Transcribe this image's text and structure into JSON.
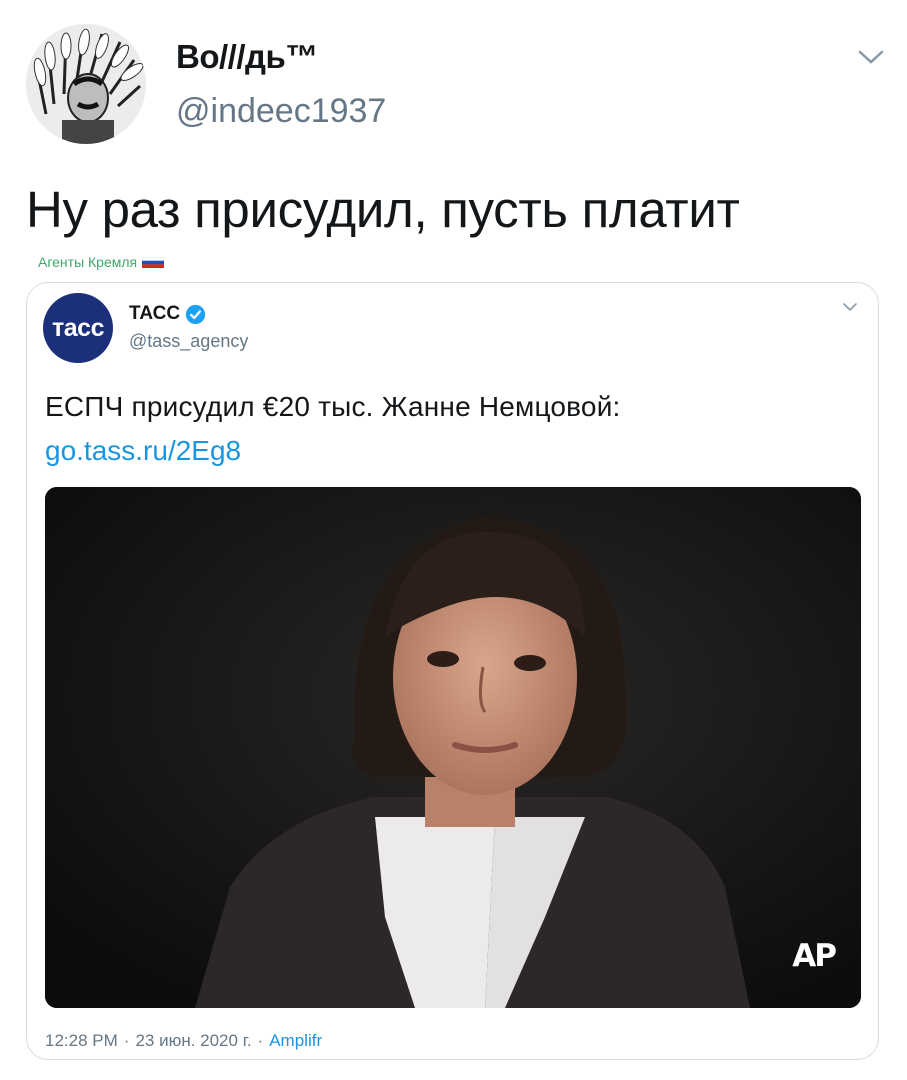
{
  "tweet": {
    "display_name": "Во///дь™",
    "handle": "@indeec1937",
    "text": "Ну раз присудил, пусть платит",
    "watermark": "Агенты Кремля",
    "avatar_icon": "profile-portrait-icon",
    "caret_icon": "chevron-down-icon"
  },
  "quoted": {
    "avatar_text": "тасс",
    "name": "ТАСС",
    "handle": "@tass_agency",
    "verified_icon": "verified-badge-icon",
    "text": "ЕСПЧ присудил €20 тыс. Жанне Немцовой:",
    "link": "go.tass.ru/2Eg8",
    "media_watermark": "AP",
    "time": "12:28 PM",
    "sep1": "·",
    "date": "23 июн. 2020 г.",
    "sep2": "·",
    "source": "Amplifr"
  },
  "colors": {
    "link": "#1b95e0",
    "secondary_text": "#657786",
    "tass_brand": "#1c2f7a",
    "watermark_green": "#3fa86a"
  }
}
